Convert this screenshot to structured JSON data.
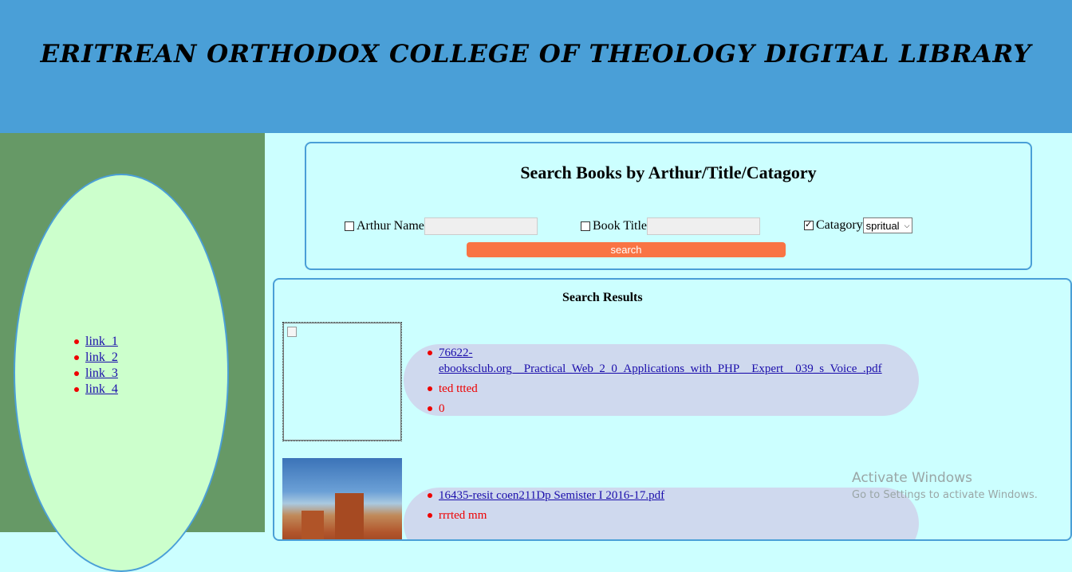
{
  "header": {
    "title": "ERITREAN ORTHODOX COLLEGE OF THEOLOGY DIGITAL LIBRARY"
  },
  "sidebar": {
    "links": [
      "link_1",
      "link_2",
      "link_3",
      "link_4"
    ]
  },
  "search": {
    "title": "Search Books by Arthur/Title/Catagory",
    "author_label": "Arthur Name",
    "author_value": "",
    "author_checked": false,
    "title_label": "Book Title",
    "title_value": "",
    "title_checked": false,
    "category_label": "Catagory",
    "category_checked": true,
    "category_selected": "spritual",
    "button_label": "search"
  },
  "results": {
    "title": "Search Results",
    "items": [
      {
        "file_line1": "76622-",
        "file_line2": "ebooksclub.org__Practical_Web_2_0_Applications_with_PHP__Expert__039_s_Voice_.pdf",
        "author": "ted ttted",
        "count": "0"
      },
      {
        "file": "16435-resit coen211Dp Semister I 2016-17.pdf",
        "author": "rrrted mm"
      }
    ]
  },
  "watermark": {
    "line1": "Activate Windows",
    "line2": "Go to Settings to activate Windows."
  }
}
